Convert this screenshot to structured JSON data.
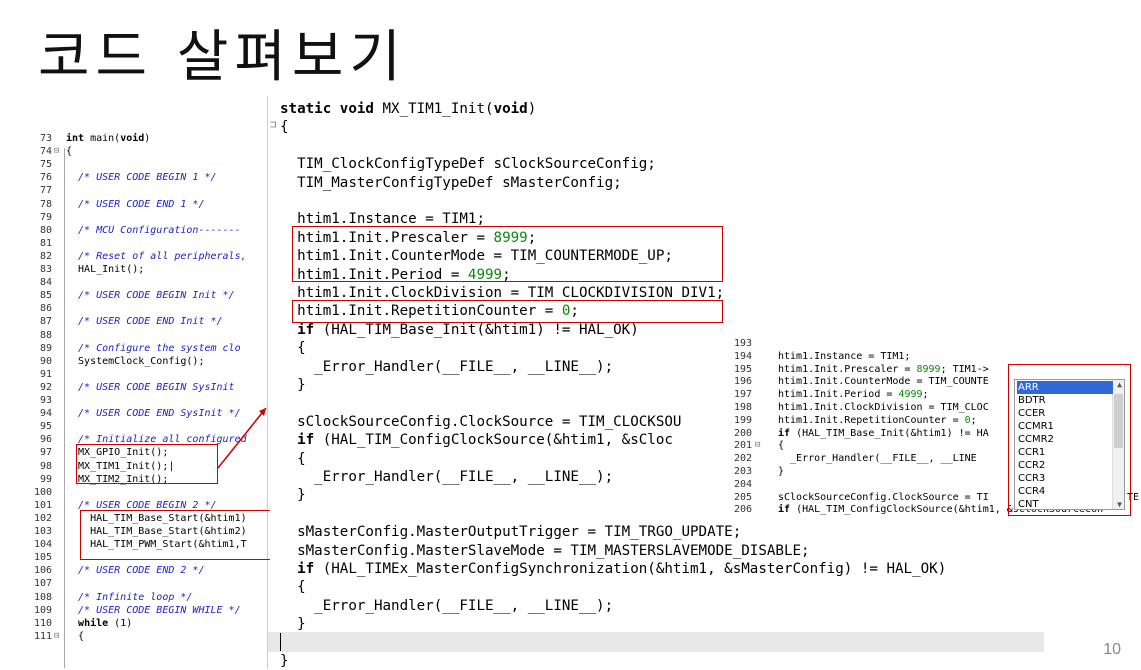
{
  "title": "코드 살펴보기",
  "page_number": "10",
  "left_editor": {
    "lines": [
      {
        "n": "73",
        "t": "int main(void)",
        "cls": "kwline"
      },
      {
        "n": "74",
        "t": "{",
        "fold": "⊟"
      },
      {
        "n": "75",
        "t": ""
      },
      {
        "n": "76",
        "t": "  /* USER CODE BEGIN 1 */",
        "cls": "cmt"
      },
      {
        "n": "77",
        "t": ""
      },
      {
        "n": "78",
        "t": "  /* USER CODE END 1 */",
        "cls": "cmt"
      },
      {
        "n": "79",
        "t": ""
      },
      {
        "n": "80",
        "t": "  /* MCU Configuration-------",
        "cls": "cmt"
      },
      {
        "n": "81",
        "t": ""
      },
      {
        "n": "82",
        "t": "  /* Reset of all peripherals,",
        "cls": "cmt"
      },
      {
        "n": "83",
        "t": "  HAL_Init();"
      },
      {
        "n": "84",
        "t": ""
      },
      {
        "n": "85",
        "t": "  /* USER CODE BEGIN Init */",
        "cls": "cmt"
      },
      {
        "n": "86",
        "t": ""
      },
      {
        "n": "87",
        "t": "  /* USER CODE END Init */",
        "cls": "cmt"
      },
      {
        "n": "88",
        "t": ""
      },
      {
        "n": "89",
        "t": "  /* Configure the system clo",
        "cls": "cmt"
      },
      {
        "n": "90",
        "t": "  SystemClock_Config();"
      },
      {
        "n": "91",
        "t": ""
      },
      {
        "n": "92",
        "t": "  /* USER CODE BEGIN SysInit",
        "cls": "cmt"
      },
      {
        "n": "93",
        "t": ""
      },
      {
        "n": "94",
        "t": "  /* USER CODE END SysInit */",
        "cls": "cmt"
      },
      {
        "n": "95",
        "t": ""
      },
      {
        "n": "96",
        "t": "  /* Initialize all configured",
        "cls": "cmt"
      },
      {
        "n": "97",
        "t": "  MX_GPIO_Init();"
      },
      {
        "n": "98",
        "t": "  MX_TIM1_Init();|"
      },
      {
        "n": "99",
        "t": "  MX_TIM2_Init();"
      },
      {
        "n": "100",
        "t": ""
      },
      {
        "n": "101",
        "t": "  /* USER CODE BEGIN 2 */",
        "cls": "cmt"
      },
      {
        "n": "102",
        "t": "    HAL_TIM_Base_Start(&htim1)"
      },
      {
        "n": "103",
        "t": "    HAL_TIM_Base_Start(&htim2)"
      },
      {
        "n": "104",
        "t": "    HAL_TIM_PWM_Start(&htim1,T"
      },
      {
        "n": "105",
        "t": ""
      },
      {
        "n": "106",
        "t": "  /* USER CODE END 2 */",
        "cls": "cmt"
      },
      {
        "n": "107",
        "t": ""
      },
      {
        "n": "108",
        "t": "  /* Infinite loop */",
        "cls": "cmt"
      },
      {
        "n": "109",
        "t": "  /* USER CODE BEGIN WHILE */",
        "cls": "cmt"
      },
      {
        "n": "110",
        "t": "  while (1)",
        "cls": "kwline2"
      },
      {
        "n": "111",
        "t": "  {",
        "fold": "⊟"
      }
    ]
  },
  "main_code": {
    "lines": [
      "static void MX_TIM1_Init(void)",
      "{",
      "",
      "  TIM_ClockConfigTypeDef sClockSourceConfig;",
      "  TIM_MasterConfigTypeDef sMasterConfig;",
      "",
      "  htim1.Instance = TIM1;",
      "  htim1.Init.Prescaler = 8999;",
      "  htim1.Init.CounterMode = TIM_COUNTERMODE_UP;",
      "  htim1.Init.Period = 4999;",
      "  htim1.Init.ClockDivision = TIM_CLOCKDIVISION_DIV1;",
      "  htim1.Init.RepetitionCounter = 0;",
      "  if (HAL_TIM_Base_Init(&htim1) != HAL_OK)",
      "  {",
      "    _Error_Handler(__FILE__, __LINE__);",
      "  }",
      "",
      "  sClockSourceConfig.ClockSource = TIM_CLOCKSOU",
      "  if (HAL_TIM_ConfigClockSource(&htim1, &sCloc",
      "  {",
      "    _Error_Handler(__FILE__, __LINE__);",
      "  }",
      "",
      "  sMasterConfig.MasterOutputTrigger = TIM_TRGO_UPDATE;",
      "  sMasterConfig.MasterSlaveMode = TIM_MASTERSLAVEMODE_DISABLE;",
      "  if (HAL_TIMEx_MasterConfigSynchronization(&htim1, &sMasterConfig) != HAL_OK)",
      "  {",
      "    _Error_Handler(__FILE__, __LINE__);",
      "  }",
      "",
      "}"
    ]
  },
  "zoom_editor": {
    "lines": [
      {
        "n": "193",
        "t": ""
      },
      {
        "n": "194",
        "t": "htim1.Instance = TIM1;"
      },
      {
        "n": "195",
        "t": "htim1.Init.Prescaler = 8999; TIM1->"
      },
      {
        "n": "196",
        "t": "htim1.Init.CounterMode = TIM_COUNTE"
      },
      {
        "n": "197",
        "t": "htim1.Init.Period = 4999;"
      },
      {
        "n": "198",
        "t": "htim1.Init.ClockDivision = TIM_CLOC"
      },
      {
        "n": "199",
        "t": "htim1.Init.RepetitionCounter = 0;"
      },
      {
        "n": "200",
        "t": "if (HAL_TIM_Base_Init(&htim1) != HA"
      },
      {
        "n": "201",
        "t": "{",
        "fold": "⊟"
      },
      {
        "n": "202",
        "t": "  _Error_Handler(__FILE__, __LINE"
      },
      {
        "n": "203",
        "t": "}"
      },
      {
        "n": "204",
        "t": ""
      },
      {
        "n": "205",
        "t": "sClockSourceConfig.ClockSource = TI"
      },
      {
        "n": "206",
        "t": "if (HAL_TIM_ConfigClockSource(&htim1, &sClockSourceCon"
      }
    ]
  },
  "autocomplete": {
    "items": [
      "ARR",
      "BDTR",
      "CCER",
      "CCMR1",
      "CCMR2",
      "CCR1",
      "CCR2",
      "CCR3",
      "CCR4",
      "CNT"
    ],
    "selected": "ARR",
    "trailing_text": "TE"
  },
  "colors": {
    "highlight_box": "#c00000",
    "comment": "#2121c8",
    "number": "#0a8a0a",
    "selection": "#3069d6"
  }
}
